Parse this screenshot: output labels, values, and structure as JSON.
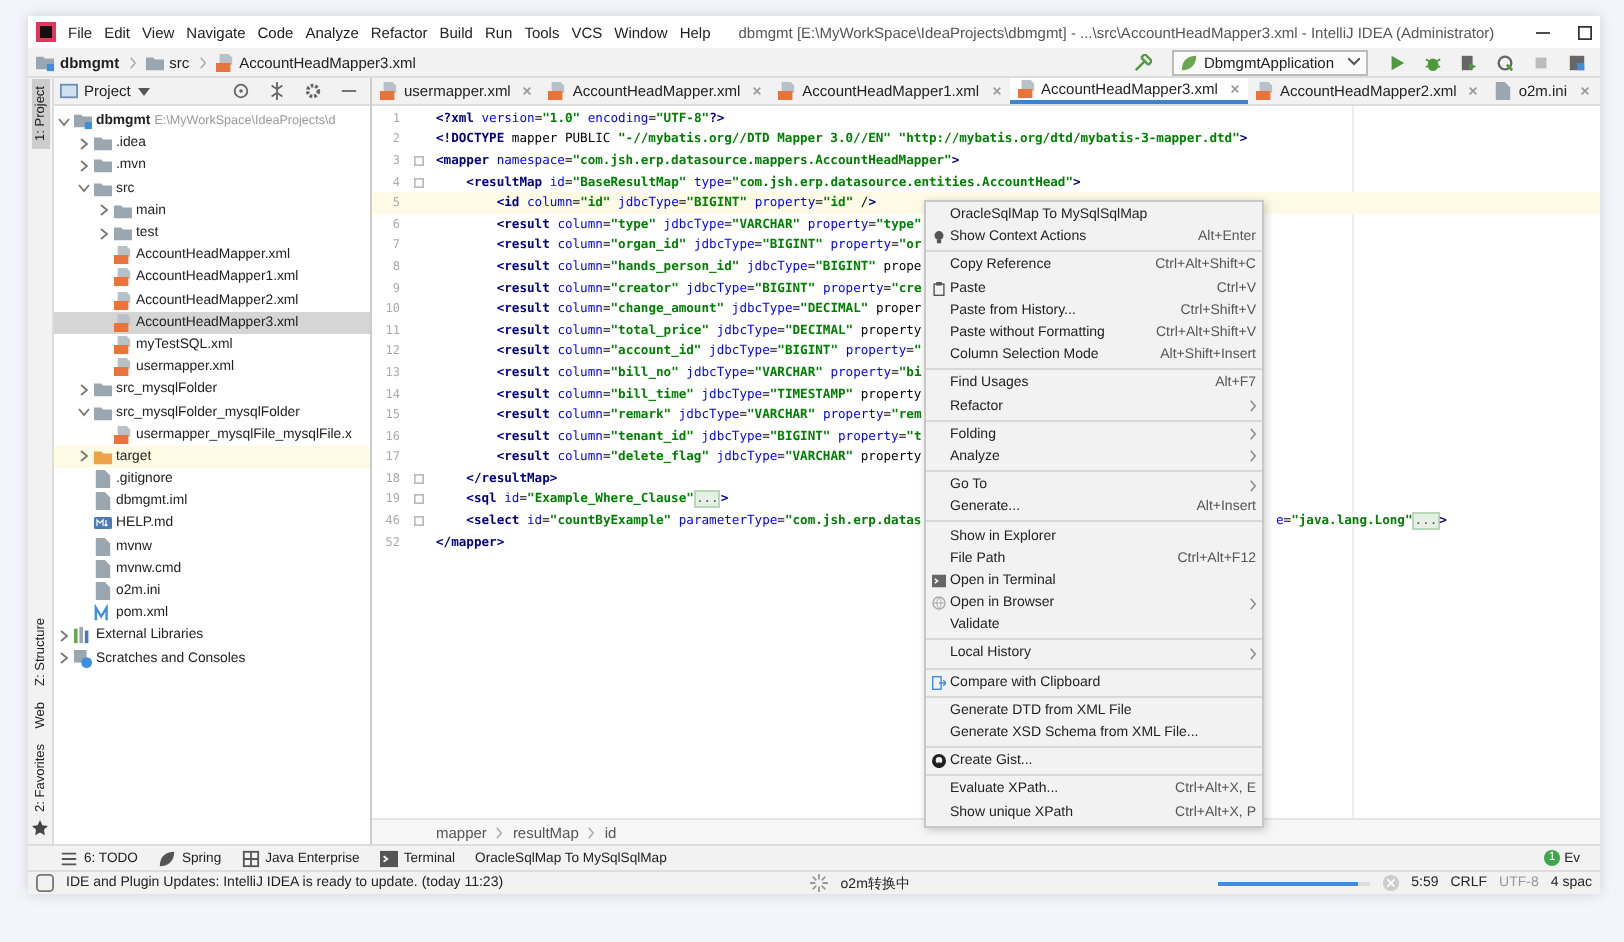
{
  "window": {
    "title": "dbmgmt [E:\\MyWorkSpace\\IdeaProjects\\dbmgmt] - ...\\src\\AccountHeadMapper3.xml - IntelliJ IDEA (Administrator)"
  },
  "menu_bar": [
    "File",
    "Edit",
    "View",
    "Navigate",
    "Code",
    "Analyze",
    "Refactor",
    "Build",
    "Run",
    "Tools",
    "VCS",
    "Window",
    "Help"
  ],
  "nav_bar": {
    "crumbs": [
      {
        "label": "dbmgmt",
        "kind": "module"
      },
      {
        "label": "src",
        "kind": "folder"
      },
      {
        "label": "AccountHeadMapper3.xml",
        "kind": "xml"
      }
    ],
    "run_config": "DbmgmtApplication"
  },
  "left_strip": {
    "top": [
      {
        "label": "1: Project",
        "selected": true
      }
    ],
    "bottom": [
      {
        "label": "Z: Structure",
        "selected": false
      },
      {
        "label": "Web",
        "selected": false
      },
      {
        "label": "2: Favorites",
        "selected": false
      }
    ]
  },
  "project_panel": {
    "title": "Project",
    "tree": [
      {
        "label": "dbmgmt",
        "hint": "E:\\MyWorkSpace\\IdeaProjects\\d",
        "kind": "module",
        "expanded": true,
        "selected": false,
        "children": [
          {
            "label": ".idea",
            "kind": "folder",
            "expanded": false,
            "selected": false
          },
          {
            "label": ".mvn",
            "kind": "folder",
            "expanded": false,
            "selected": false
          },
          {
            "label": "src",
            "kind": "folder",
            "expanded": true,
            "selected": false,
            "children": [
              {
                "label": "main",
                "kind": "folder",
                "expanded": false,
                "selected": false
              },
              {
                "label": "test",
                "kind": "folder",
                "expanded": false,
                "selected": false
              },
              {
                "label": "AccountHeadMapper.xml",
                "kind": "xml",
                "selected": false
              },
              {
                "label": "AccountHeadMapper1.xml",
                "kind": "xml",
                "selected": false
              },
              {
                "label": "AccountHeadMapper2.xml",
                "kind": "xml",
                "selected": false
              },
              {
                "label": "AccountHeadMapper3.xml",
                "kind": "xml",
                "selected": true
              },
              {
                "label": "myTestSQL.xml",
                "kind": "xml",
                "selected": false
              },
              {
                "label": "usermapper.xml",
                "kind": "xml",
                "selected": false
              }
            ]
          },
          {
            "label": "src_mysqlFolder",
            "kind": "folder",
            "expanded": false,
            "selected": false
          },
          {
            "label": "src_mysqlFolder_mysqlFolder",
            "kind": "folder",
            "expanded": true,
            "selected": false,
            "children": [
              {
                "label": "usermapper_mysqlFile_mysqlFile.x",
                "kind": "xml",
                "selected": false
              }
            ]
          },
          {
            "label": "target",
            "kind": "excluded",
            "expanded": false,
            "selected": false
          },
          {
            "label": ".gitignore",
            "kind": "file",
            "selected": false
          },
          {
            "label": "dbmgmt.iml",
            "kind": "file",
            "selected": false
          },
          {
            "label": "HELP.md",
            "kind": "markdown",
            "selected": false
          },
          {
            "label": "mvnw",
            "kind": "file",
            "selected": false
          },
          {
            "label": "mvnw.cmd",
            "kind": "file",
            "selected": false
          },
          {
            "label": "o2m.ini",
            "kind": "file",
            "selected": false
          },
          {
            "label": "pom.xml",
            "kind": "maven",
            "selected": false
          }
        ]
      },
      {
        "label": "External Libraries",
        "kind": "library",
        "expanded": false,
        "selected": false
      },
      {
        "label": "Scratches and Consoles",
        "kind": "scratches",
        "expanded": false,
        "selected": false
      }
    ]
  },
  "editor_tabs": [
    {
      "label": "usermapper.xml",
      "kind": "xml",
      "selected": false
    },
    {
      "label": "AccountHeadMapper.xml",
      "kind": "xml",
      "selected": false
    },
    {
      "label": "AccountHeadMapper1.xml",
      "kind": "xml",
      "selected": false
    },
    {
      "label": "AccountHeadMapper3.xml",
      "kind": "xml",
      "selected": true
    },
    {
      "label": "AccountHeadMapper2.xml",
      "kind": "xml",
      "selected": false
    },
    {
      "label": "o2m.ini",
      "kind": "file",
      "selected": false
    }
  ],
  "code_lines": [
    {
      "number": "1",
      "fold": false,
      "current": false,
      "segments": [
        {
          "kind": "code",
          "text": "<?xml version=\"1.0\" encoding=\"UTF-8\"?>"
        }
      ]
    },
    {
      "number": "2",
      "fold": false,
      "current": false,
      "segments": [
        {
          "kind": "code",
          "text": "<!DOCTYPE mapper PUBLIC \"-//mybatis.org//DTD Mapper 3.0//EN\" \"http://mybatis.org/dtd/mybatis-3-mapper.dtd\">"
        }
      ]
    },
    {
      "number": "3",
      "fold": true,
      "current": false,
      "segments": [
        {
          "kind": "code",
          "text": "<mapper namespace=\"com.jsh.erp.datasource.mappers.AccountHeadMapper\">"
        }
      ]
    },
    {
      "number": "4",
      "fold": true,
      "current": false,
      "segments": [
        {
          "kind": "code",
          "text": "    <resultMap id=\"BaseResultMap\" type=\"com.jsh.erp.datasource.entities.AccountHead\">"
        }
      ]
    },
    {
      "number": "5",
      "fold": false,
      "current": true,
      "segments": [
        {
          "kind": "code",
          "text": "        <id column=\"id\" jdbcType=\"BIGINT\" property=\"id\" />"
        }
      ]
    },
    {
      "number": "6",
      "fold": false,
      "current": false,
      "segments": [
        {
          "kind": "code",
          "text": "        <result column=\"type\" jdbcType=\"VARCHAR\" property=\"type\""
        }
      ]
    },
    {
      "number": "7",
      "fold": false,
      "current": false,
      "segments": [
        {
          "kind": "code",
          "text": "        <result column=\"organ_id\" jdbcType=\"BIGINT\" property=\"or"
        }
      ]
    },
    {
      "number": "8",
      "fold": false,
      "current": false,
      "segments": [
        {
          "kind": "code",
          "text": "        <result column=\"hands_person_id\" jdbcType=\"BIGINT\" prope"
        }
      ]
    },
    {
      "number": "9",
      "fold": false,
      "current": false,
      "segments": [
        {
          "kind": "code",
          "text": "        <result column=\"creator\" jdbcType=\"BIGINT\" property=\"cre"
        }
      ]
    },
    {
      "number": "10",
      "fold": false,
      "current": false,
      "segments": [
        {
          "kind": "code",
          "text": "        <result column=\"change_amount\" jdbcType=\"DECIMAL\" proper"
        }
      ]
    },
    {
      "number": "11",
      "fold": false,
      "current": false,
      "segments": [
        {
          "kind": "code",
          "text": "        <result column=\"total_price\" jdbcType=\"DECIMAL\" property"
        }
      ]
    },
    {
      "number": "12",
      "fold": false,
      "current": false,
      "segments": [
        {
          "kind": "code",
          "text": "        <result column=\"account_id\" jdbcType=\"BIGINT\" property=\""
        }
      ]
    },
    {
      "number": "13",
      "fold": false,
      "current": false,
      "segments": [
        {
          "kind": "code",
          "text": "        <result column=\"bill_no\" jdbcType=\"VARCHAR\" property=\"bi"
        }
      ]
    },
    {
      "number": "14",
      "fold": false,
      "current": false,
      "segments": [
        {
          "kind": "code",
          "text": "        <result column=\"bill_time\" jdbcType=\"TIMESTAMP\" property"
        }
      ]
    },
    {
      "number": "15",
      "fold": false,
      "current": false,
      "segments": [
        {
          "kind": "code",
          "text": "        <result column=\"remark\" jdbcType=\"VARCHAR\" property=\"rem"
        }
      ]
    },
    {
      "number": "16",
      "fold": false,
      "current": false,
      "segments": [
        {
          "kind": "code",
          "text": "        <result column=\"tenant_id\" jdbcType=\"BIGINT\" property=\"t"
        }
      ]
    },
    {
      "number": "17",
      "fold": false,
      "current": false,
      "segments": [
        {
          "kind": "code",
          "text": "        <result column=\"delete_flag\" jdbcType=\"VARCHAR\" property"
        }
      ]
    },
    {
      "number": "18",
      "fold": true,
      "current": false,
      "segments": [
        {
          "kind": "code",
          "text": "    </resultMap>"
        }
      ]
    },
    {
      "number": "19",
      "fold": true,
      "current": false,
      "segments": [
        {
          "kind": "code",
          "text": "    <sql id=\"Example_Where_Clause\""
        },
        {
          "kind": "fold",
          "text": "..."
        },
        {
          "kind": "code",
          "text": ">"
        }
      ]
    },
    {
      "number": "46",
      "fold": true,
      "current": false,
      "segments": [
        {
          "kind": "code",
          "text": "    <select id=\"countByExample\" parameterType=\"com.jsh.erp.datas"
        }
      ],
      "segments_right": [
        {
          "kind": "code",
          "text": "e=\"java.lang.Long\""
        },
        {
          "kind": "fold",
          "text": "..."
        },
        {
          "kind": "code",
          "text": ">"
        }
      ]
    },
    {
      "number": "52",
      "fold": false,
      "current": false,
      "segments": [
        {
          "kind": "code",
          "text": "</mapper>"
        }
      ]
    }
  ],
  "context_menu": [
    [
      {
        "label": "OracleSqlMap To MySqlSqlMap",
        "kind": "plain",
        "submenu": false
      },
      {
        "label": "Show Context Actions",
        "shortcut": "Alt+Enter",
        "kind": "bulb",
        "submenu": false
      }
    ],
    [
      {
        "label": "Copy Reference",
        "shortcut": "Ctrl+Alt+Shift+C",
        "kind": "plain",
        "submenu": false
      },
      {
        "label": "Paste",
        "shortcut": "Ctrl+V",
        "kind": "clipboard",
        "submenu": false
      },
      {
        "label": "Paste from History...",
        "shortcut": "Ctrl+Shift+V",
        "kind": "plain",
        "submenu": false
      },
      {
        "label": "Paste without Formatting",
        "shortcut": "Ctrl+Alt+Shift+V",
        "kind": "plain",
        "submenu": false
      },
      {
        "label": "Column Selection Mode",
        "shortcut": "Alt+Shift+Insert",
        "kind": "plain",
        "submenu": false
      }
    ],
    [
      {
        "label": "Find Usages",
        "shortcut": "Alt+F7",
        "kind": "plain",
        "submenu": false
      },
      {
        "label": "Refactor",
        "kind": "plain",
        "submenu": true
      }
    ],
    [
      {
        "label": "Folding",
        "kind": "plain",
        "submenu": true
      },
      {
        "label": "Analyze",
        "kind": "plain",
        "submenu": true
      }
    ],
    [
      {
        "label": "Go To",
        "kind": "plain",
        "submenu": true
      },
      {
        "label": "Generate...",
        "shortcut": "Alt+Insert",
        "kind": "plain",
        "submenu": false
      }
    ],
    [
      {
        "label": "Show in Explorer",
        "kind": "plain",
        "submenu": false
      },
      {
        "label": "File Path",
        "shortcut": "Ctrl+Alt+F12",
        "kind": "plain",
        "submenu": false
      },
      {
        "label": "Open in Terminal",
        "kind": "terminal",
        "submenu": false
      },
      {
        "label": "Open in Browser",
        "kind": "globe",
        "submenu": true
      },
      {
        "label": "Validate",
        "kind": "plain",
        "submenu": false
      }
    ],
    [
      {
        "label": "Local History",
        "kind": "plain",
        "submenu": true
      }
    ],
    [
      {
        "label": "Compare with Clipboard",
        "kind": "compare",
        "submenu": false
      }
    ],
    [
      {
        "label": "Generate DTD from XML File",
        "kind": "plain",
        "submenu": false
      },
      {
        "label": "Generate XSD Schema from XML File...",
        "kind": "plain",
        "submenu": false
      }
    ],
    [
      {
        "label": "Create Gist...",
        "kind": "gist",
        "submenu": false
      }
    ],
    [
      {
        "label": "Evaluate XPath...",
        "shortcut": "Ctrl+Alt+X, E",
        "kind": "plain",
        "submenu": false
      },
      {
        "label": "Show unique XPath",
        "shortcut": "Ctrl+Alt+X, P",
        "kind": "plain",
        "submenu": false
      }
    ]
  ],
  "breadcrumbs": [
    "mapper",
    "resultMap",
    "id"
  ],
  "tool_tabs": [
    {
      "label": "6: TODO",
      "kind": "todo"
    },
    {
      "label": "Spring",
      "kind": "spring"
    },
    {
      "label": "Java Enterprise",
      "kind": "enterprise"
    },
    {
      "label": "Terminal",
      "kind": "terminal"
    },
    {
      "label": "OracleSqlMap To MySqlSqlMap",
      "kind": "plain"
    }
  ],
  "event_log": {
    "badge": "1",
    "label": "Ev"
  },
  "status_bar": {
    "message": "IDE and Plugin Updates: IntelliJ IDEA is ready to update. (today 11:23)",
    "task": "o2m转换中",
    "level": 0.92,
    "position": "5:59",
    "line_separator": "CRLF",
    "encoding": "UTF-8",
    "indent": "4 spac"
  }
}
